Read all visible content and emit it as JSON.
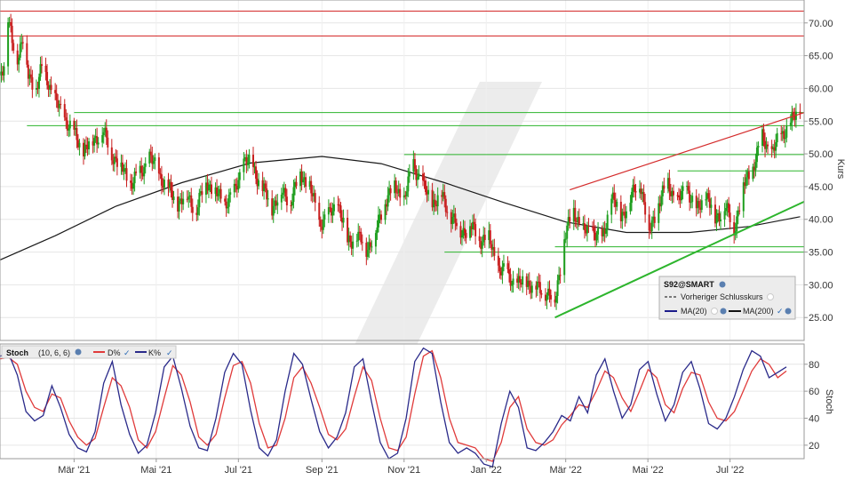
{
  "colors": {
    "up": "#1e9e1e",
    "down": "#c81e1e",
    "ma20": "#1b1b8a",
    "ma200": "#1a1a1a",
    "support_line": "#2db52d",
    "resistance_red": "#d42a2a",
    "stoch_d": "#e03a3a",
    "stoch_k": "#2a2a8a",
    "watermark": "#dcdcdc"
  },
  "chart_data": [
    {
      "type": "candlestick",
      "title": "",
      "xlabel": "",
      "ylabel": "Kurs",
      "ylim": [
        21.5,
        73.5
      ],
      "yticks": [
        "25.00",
        "30.00",
        "35.00",
        "40.00",
        "45.00",
        "50.00",
        "55.00",
        "60.00",
        "65.00",
        "70.00"
      ],
      "x_tick_labels": [
        "Mär '21",
        "Mai '21",
        "Jul '21",
        "Sep '21",
        "Nov '21",
        "Jan '22",
        "Mär '22",
        "Mai '22",
        "Jul '22"
      ],
      "x_range": [
        "2021-01-05",
        "2022-08-25"
      ],
      "legend": {
        "symbol": "S92@SMART",
        "previous_close_label": "Vorheriger Schlusskurs",
        "ma20_label": "MA(20)",
        "ma200_label": "MA(200)",
        "placement": "bottom-right"
      },
      "price_path": [
        [
          "2021-01-05",
          62.0
        ],
        [
          "2021-01-08",
          64.0
        ],
        [
          "2021-01-11",
          70.5
        ],
        [
          "2021-01-14",
          67.0
        ],
        [
          "2021-01-18",
          65.0
        ],
        [
          "2021-01-22",
          67.5
        ],
        [
          "2021-01-26",
          62.0
        ],
        [
          "2021-02-01",
          60.0
        ],
        [
          "2021-02-05",
          63.0
        ],
        [
          "2021-02-10",
          61.0
        ],
        [
          "2021-02-15",
          58.0
        ],
        [
          "2021-02-22",
          55.5
        ],
        [
          "2021-03-01",
          53.0
        ],
        [
          "2021-03-08",
          50.5
        ],
        [
          "2021-03-15",
          52.0
        ],
        [
          "2021-03-22",
          53.5
        ],
        [
          "2021-03-29",
          50.0
        ],
        [
          "2021-04-05",
          48.0
        ],
        [
          "2021-04-12",
          45.5
        ],
        [
          "2021-04-19",
          47.0
        ],
        [
          "2021-04-26",
          49.5
        ],
        [
          "2021-05-03",
          47.0
        ],
        [
          "2021-05-10",
          44.5
        ],
        [
          "2021-05-17",
          42.5
        ],
        [
          "2021-05-24",
          43.5
        ],
        [
          "2021-05-31",
          41.5
        ],
        [
          "2021-06-07",
          46.0
        ],
        [
          "2021-06-14",
          44.0
        ],
        [
          "2021-06-21",
          42.5
        ],
        [
          "2021-06-28",
          44.0
        ],
        [
          "2021-07-05",
          49.0
        ],
        [
          "2021-07-12",
          48.0
        ],
        [
          "2021-07-19",
          44.5
        ],
        [
          "2021-07-26",
          42.0
        ],
        [
          "2021-08-02",
          44.0
        ],
        [
          "2021-08-09",
          43.0
        ],
        [
          "2021-08-16",
          47.0
        ],
        [
          "2021-08-23",
          45.0
        ],
        [
          "2021-08-30",
          39.5
        ],
        [
          "2021-09-06",
          40.5
        ],
        [
          "2021-09-13",
          42.5
        ],
        [
          "2021-09-20",
          36.5
        ],
        [
          "2021-09-27",
          37.5
        ],
        [
          "2021-10-04",
          35.5
        ],
        [
          "2021-10-11",
          38.0
        ],
        [
          "2021-10-18",
          43.0
        ],
        [
          "2021-10-25",
          45.0
        ],
        [
          "2021-11-01",
          43.0
        ],
        [
          "2021-11-08",
          48.5
        ],
        [
          "2021-11-15",
          45.0
        ],
        [
          "2021-11-22",
          42.5
        ],
        [
          "2021-11-29",
          43.5
        ],
        [
          "2021-12-06",
          40.5
        ],
        [
          "2021-12-13",
          38.0
        ],
        [
          "2021-12-20",
          39.0
        ],
        [
          "2021-12-27",
          37.0
        ],
        [
          "2022-01-03",
          37.0
        ],
        [
          "2022-01-10",
          32.5
        ],
        [
          "2022-01-17",
          31.5
        ],
        [
          "2022-01-24",
          30.0
        ],
        [
          "2022-01-31",
          30.5
        ],
        [
          "2022-02-07",
          29.5
        ],
        [
          "2022-02-14",
          29.0
        ],
        [
          "2022-02-21",
          27.5
        ],
        [
          "2022-02-28",
          37.0
        ],
        [
          "2022-03-07",
          41.5
        ],
        [
          "2022-03-14",
          38.0
        ],
        [
          "2022-03-21",
          38.5
        ],
        [
          "2022-03-28",
          36.5
        ],
        [
          "2022-04-04",
          43.5
        ],
        [
          "2022-04-11",
          40.5
        ],
        [
          "2022-04-18",
          43.0
        ],
        [
          "2022-04-25",
          46.0
        ],
        [
          "2022-05-02",
          38.0
        ],
        [
          "2022-05-09",
          42.5
        ],
        [
          "2022-05-16",
          45.5
        ],
        [
          "2022-05-23",
          42.5
        ],
        [
          "2022-05-30",
          45.0
        ],
        [
          "2022-06-06",
          41.0
        ],
        [
          "2022-06-13",
          44.0
        ],
        [
          "2022-06-20",
          40.0
        ],
        [
          "2022-06-27",
          42.0
        ],
        [
          "2022-07-04",
          38.5
        ],
        [
          "2022-07-11",
          45.0
        ],
        [
          "2022-07-18",
          48.0
        ],
        [
          "2022-07-25",
          52.5
        ],
        [
          "2022-08-01",
          50.0
        ],
        [
          "2022-08-08",
          53.0
        ],
        [
          "2022-08-15",
          54.5
        ],
        [
          "2022-08-22",
          57.5
        ]
      ],
      "ma200_path": [
        [
          "2021-01-05",
          33.8
        ],
        [
          "2021-02-15",
          37.5
        ],
        [
          "2021-04-01",
          42.0
        ],
        [
          "2021-05-20",
          45.6
        ],
        [
          "2021-07-10",
          48.6
        ],
        [
          "2021-09-01",
          49.6
        ],
        [
          "2021-10-15",
          48.5
        ],
        [
          "2021-12-01",
          45.6
        ],
        [
          "2022-01-15",
          42.5
        ],
        [
          "2022-03-01",
          39.6
        ],
        [
          "2022-04-15",
          38.0
        ],
        [
          "2022-06-01",
          38.0
        ],
        [
          "2022-07-15",
          38.9
        ],
        [
          "2022-08-22",
          40.4
        ]
      ],
      "horizontal_lines": [
        {
          "kind": "red",
          "y": 71.8,
          "from": "2021-01-05",
          "to": "2022-08-25"
        },
        {
          "kind": "red",
          "y": 68.0,
          "from": "2021-01-05",
          "to": "2022-08-25"
        },
        {
          "kind": "green",
          "y": 56.3,
          "from": "2021-03-01",
          "to": "2022-08-25"
        },
        {
          "kind": "green",
          "y": 54.3,
          "from": "2021-01-25",
          "to": "2022-08-25"
        },
        {
          "kind": "green",
          "y": 49.9,
          "from": "2021-11-01",
          "to": "2022-08-25"
        },
        {
          "kind": "green",
          "y": 47.4,
          "from": "2022-05-23",
          "to": "2022-08-25"
        },
        {
          "kind": "green",
          "y": 35.8,
          "from": "2022-02-21",
          "to": "2022-08-25"
        },
        {
          "kind": "green",
          "y": 35.0,
          "from": "2021-12-01",
          "to": "2022-08-25"
        }
      ],
      "trend_lines": [
        {
          "kind": "support",
          "x1": "2022-02-21",
          "y1": 25.0,
          "x2": "2022-08-25",
          "y2": 42.7
        },
        {
          "kind": "resistance",
          "x1": "2022-03-04",
          "y1": 44.5,
          "x2": "2022-08-25",
          "y2": 56.3
        }
      ]
    },
    {
      "type": "line",
      "title": "Stoch",
      "params": "(10, 6, 6)",
      "ylabel": "Stoch",
      "ylim": [
        10,
        95
      ],
      "yticks": [
        "20",
        "40",
        "60",
        "80"
      ],
      "series": [
        {
          "name": "D%",
          "values": [
            84,
            85,
            80,
            60,
            48,
            45,
            58,
            55,
            38,
            26,
            20,
            25,
            48,
            70,
            64,
            48,
            24,
            18,
            30,
            55,
            79,
            72,
            52,
            26,
            20,
            28,
            55,
            79,
            82,
            66,
            36,
            18,
            20,
            40,
            70,
            78,
            66,
            48,
            28,
            24,
            32,
            56,
            78,
            68,
            40,
            18,
            16,
            26,
            58,
            86,
            90,
            70,
            40,
            22,
            20,
            18,
            10,
            8,
            22,
            48,
            56,
            32,
            22,
            20,
            24,
            35,
            42,
            50,
            48,
            60,
            75,
            70,
            55,
            45,
            60,
            76,
            70,
            50,
            44,
            62,
            74,
            72,
            52,
            40,
            38,
            45,
            60,
            75,
            84,
            80,
            70,
            75
          ]
        },
        {
          "name": "K%",
          "values": [
            86,
            88,
            72,
            45,
            38,
            42,
            64,
            48,
            28,
            18,
            15,
            30,
            66,
            82,
            50,
            28,
            14,
            20,
            44,
            78,
            86,
            62,
            34,
            18,
            16,
            40,
            74,
            88,
            80,
            46,
            18,
            12,
            24,
            60,
            88,
            80,
            54,
            30,
            18,
            26,
            44,
            78,
            84,
            52,
            22,
            10,
            14,
            40,
            82,
            92,
            88,
            52,
            22,
            14,
            18,
            14,
            6,
            4,
            36,
            60,
            48,
            18,
            16,
            22,
            30,
            42,
            38,
            56,
            44,
            72,
            84,
            60,
            40,
            50,
            76,
            82,
            58,
            38,
            50,
            74,
            82,
            62,
            36,
            32,
            40,
            56,
            76,
            90,
            86,
            70,
            74,
            78
          ]
        }
      ]
    }
  ]
}
